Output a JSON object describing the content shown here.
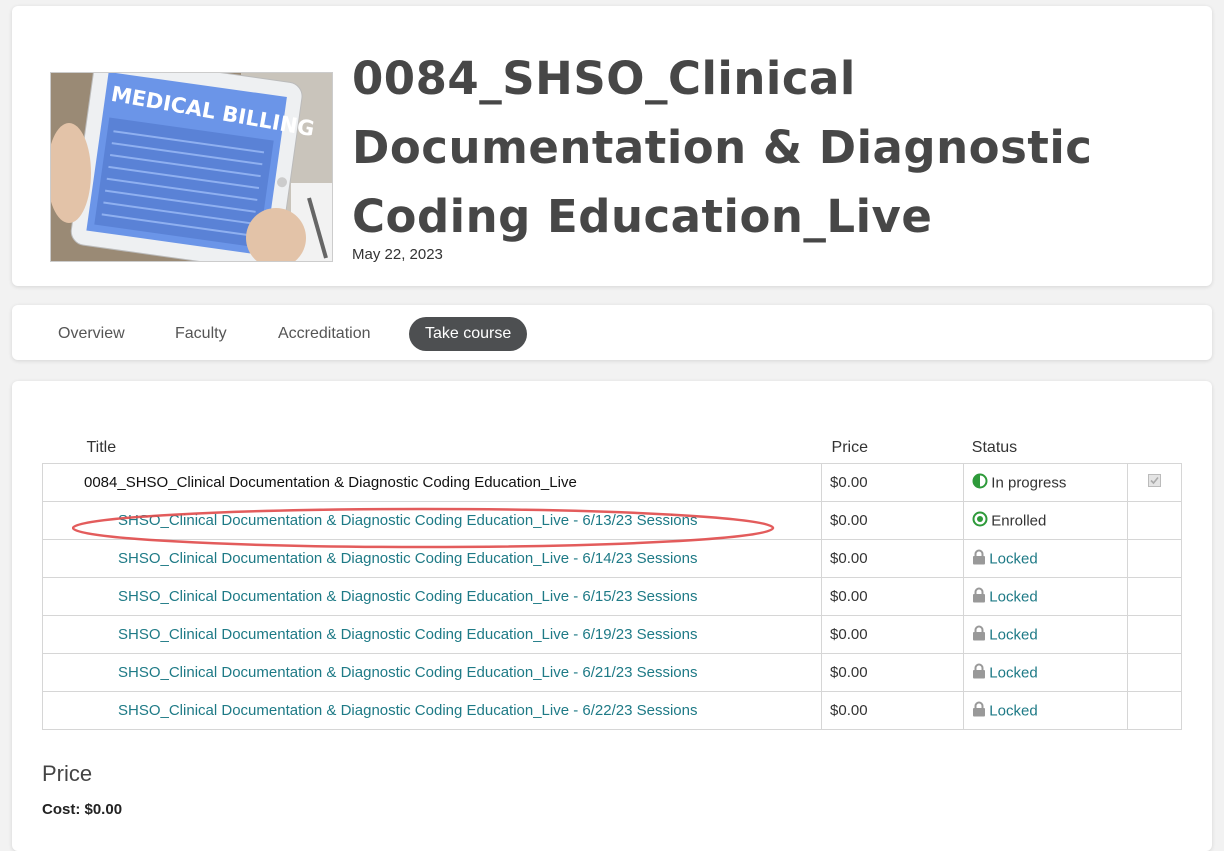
{
  "header": {
    "title": "0084_SHSO_Clinical Documentation & Diagnostic Coding Education_Live",
    "date": "May 22, 2023",
    "thumbnail": {
      "label": "MEDICAL BILLING",
      "screen_color": "#6b95e8"
    }
  },
  "tabs": [
    {
      "label": "Overview"
    },
    {
      "label": "Faculty"
    },
    {
      "label": "Accreditation"
    },
    {
      "label": "Take course",
      "active": true
    }
  ],
  "table": {
    "headers": {
      "title": "Title",
      "price": "Price",
      "status": "Status"
    },
    "parent": {
      "title": "0084_SHSO_Clinical Documentation & Diagnostic Coding Education_Live",
      "price": "$0.00",
      "status": "In progress",
      "status_icon": "half-circle-icon",
      "checked": true
    },
    "rows": [
      {
        "title": "SHSO_Clinical Documentation & Diagnostic Coding Education_Live - 6/13/23 Sessions",
        "price": "$0.00",
        "status": "Enrolled",
        "status_icon": "radio-dot-icon"
      },
      {
        "title": "SHSO_Clinical Documentation & Diagnostic Coding Education_Live - 6/14/23 Sessions",
        "price": "$0.00",
        "status": "Locked",
        "status_icon": "lock-icon"
      },
      {
        "title": "SHSO_Clinical Documentation & Diagnostic Coding Education_Live - 6/15/23 Sessions",
        "price": "$0.00",
        "status": "Locked",
        "status_icon": "lock-icon"
      },
      {
        "title": "SHSO_Clinical Documentation & Diagnostic Coding Education_Live - 6/19/23 Sessions",
        "price": "$0.00",
        "status": "Locked",
        "status_icon": "lock-icon"
      },
      {
        "title": "SHSO_Clinical Documentation & Diagnostic Coding Education_Live - 6/21/23 Sessions",
        "price": "$0.00",
        "status": "Locked",
        "status_icon": "lock-icon"
      },
      {
        "title": "SHSO_Clinical Documentation & Diagnostic Coding Education_Live - 6/22/23 Sessions",
        "price": "$0.00",
        "status": "Locked",
        "status_icon": "lock-icon"
      }
    ]
  },
  "price_section": {
    "heading": "Price",
    "cost": "Cost: $0.00"
  },
  "colors": {
    "link": "#1e7a86",
    "status_green": "#2e9a3a",
    "active_tab": "#4d4f51",
    "annotation": "#e04a4a"
  }
}
